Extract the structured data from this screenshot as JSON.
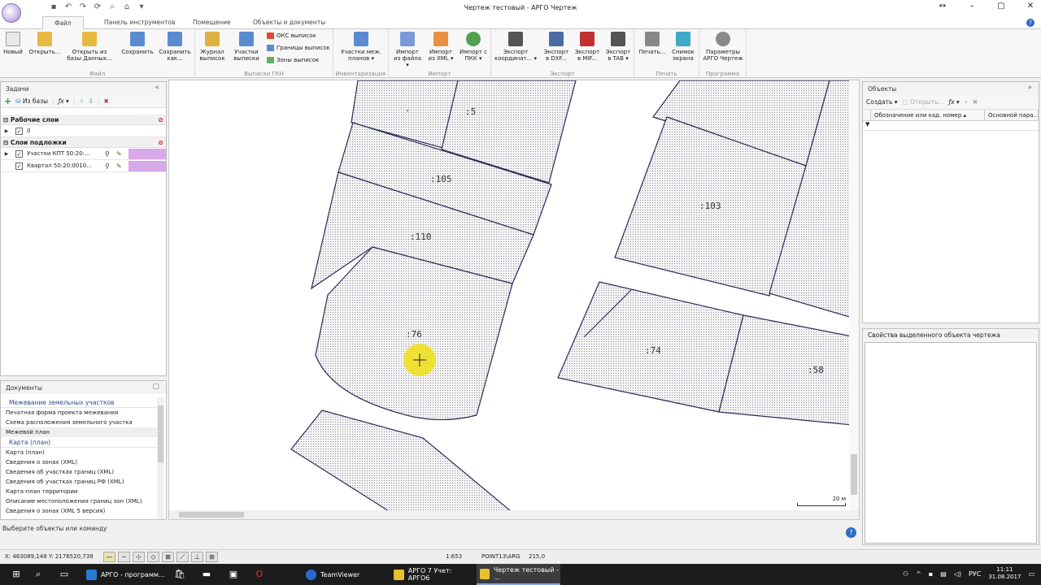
{
  "window": {
    "title": "Чертеж тестовый - АРГО Чертеж"
  },
  "ribbon_tabs": [
    "Файл",
    "Панель инструментов",
    "Помещение",
    "Объекты и документы"
  ],
  "ribbon": {
    "new": "Новый",
    "open": "Открыть...",
    "open_db": "Открыть из базы Данных...",
    "save": "Сохранить",
    "save_as": "Сохранить как...",
    "group_file": "Файл",
    "journal": "Журнал выписок",
    "parcels": "Участки выписки",
    "oks": "ОКС выписок",
    "borders": "Границы выписок",
    "zones": "Зоны выписок",
    "group_gkn": "Выписки ГКН",
    "survey_parcels": "Участки меж. планов",
    "group_inventory": "Инвентаризация",
    "import_file": "Импорт из файла",
    "import_xml": "Импорт из XML",
    "import_pkk": "Импорт с ПКК",
    "group_import": "Импорт",
    "export_coords": "Экспорт координат...",
    "export_dxf": "Экспорт в DXF...",
    "export_mif": "Экспорт в MIF...",
    "export_tab": "Экспорт в TAB",
    "group_export": "Экспорт",
    "print": "Печать...",
    "snapshot": "Снимок экрана",
    "group_print": "Печать",
    "params": "Параметры АРГО Чертеж",
    "group_program": "Программа"
  },
  "left_panel": {
    "title": "Задачи",
    "toolbar_from_db": "Из базы",
    "work_layers_title": "Рабочие слои",
    "work_layers": [
      {
        "name": "0"
      }
    ],
    "base_layers_title": "Слои подложки",
    "base_layers": [
      {
        "name": "Участки КПТ 50:20:..."
      },
      {
        "name": "Квартал 50:20:0010..."
      }
    ]
  },
  "documents": {
    "title": "Документы",
    "categories": [
      {
        "name": "Межевание земельных участков",
        "items": [
          "Печатная форма проекта межевания",
          "Схема расположения земельного участка",
          "Межевой план"
        ]
      },
      {
        "name": "Карта (план)",
        "items": [
          "Карта (план)",
          "Сведения о зонах (XML)",
          "Сведения об участках границ (XML)",
          "Сведения об участках границ РФ (XML)",
          "Карта-план территории",
          "Описание местоположения границ зон (XML)",
          "Сведения о зонах (XML 5 версия)"
        ]
      }
    ],
    "selected": "Межевой план"
  },
  "map": {
    "parcels": [
      ":5",
      ":105",
      ":110",
      ":76",
      ":103",
      ":74",
      ":58",
      "."
    ],
    "scale_label": "20 м"
  },
  "objects_panel": {
    "title": "Объекты",
    "create": "Создать",
    "open": "Открыть...",
    "columns": [
      "Обозначение или кад. номер",
      "Основной пара..."
    ]
  },
  "props_panel": {
    "title": "Свойства выделенного объекта чертежа"
  },
  "command_line": "Выберите объекты или команду",
  "status": {
    "coords": "X: 463089,148 Y: 2176520,739",
    "scale": "1:653",
    "snap": "POINT13\\ARG",
    "angle": "215,0"
  },
  "taskbar": {
    "apps": [
      "АРГО - программ...",
      "TeamViewer",
      "АРГО 7 Учет: АРГО6",
      "Чертеж тестовый - ..."
    ],
    "lang": "РУС",
    "time": "11:11",
    "date": "31.08.2017"
  }
}
